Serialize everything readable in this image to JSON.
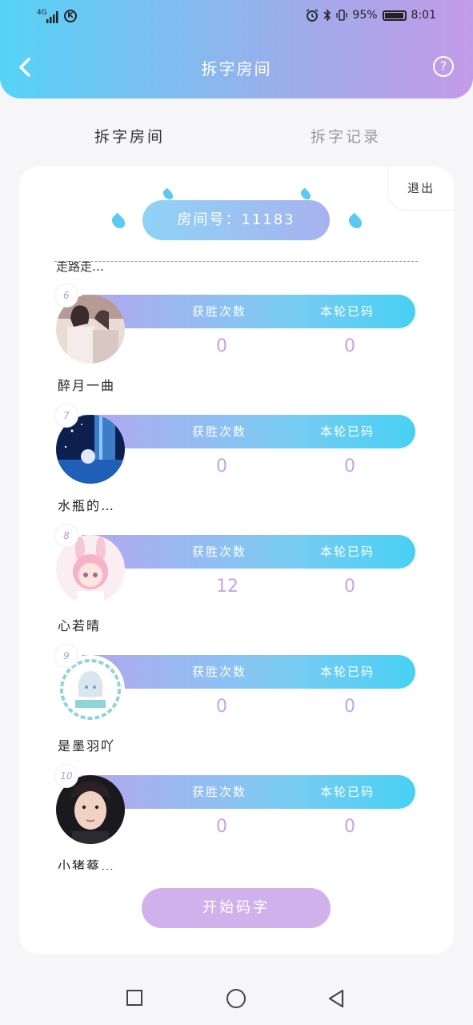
{
  "status_bar": {
    "signal": "4G",
    "k_label": "K",
    "battery_text": "95%",
    "time": "8:01"
  },
  "header": {
    "title": "拆字房间"
  },
  "tabs": [
    {
      "label": "拆字房间",
      "active": true
    },
    {
      "label": "拆字记录",
      "active": false
    }
  ],
  "room": {
    "exit_label": "退出",
    "room_label": "房间号：11183",
    "partial_name": "走路走…"
  },
  "columns": {
    "wins": "获胜次数",
    "round_coded": "本轮已码"
  },
  "players": [
    {
      "rank": "6",
      "name": "醉月一曲",
      "wins": "0",
      "coded": "0",
      "avatar": "ink-couple-avatar"
    },
    {
      "rank": "7",
      "name": "水瓶的…",
      "wins": "0",
      "coded": "0",
      "avatar": "aquarius-avatar"
    },
    {
      "rank": "8",
      "name": "心若晴",
      "wins": "12",
      "coded": "0",
      "avatar": "bunny-girl-avatar"
    },
    {
      "rank": "9",
      "name": "是墨羽吖",
      "wins": "0",
      "coded": "0",
      "avatar": "anime-badge-avatar"
    },
    {
      "rank": "10",
      "name": "小猪蔡…",
      "wins": "0",
      "coded": "0",
      "avatar": "photo-avatar"
    }
  ],
  "start_button": "开始码字",
  "colors": {
    "header_gradient_start": "#56d3f6",
    "header_gradient_end": "#c39be8",
    "row_value": "#c9a3e6",
    "start_button": "#d0b1ec"
  }
}
